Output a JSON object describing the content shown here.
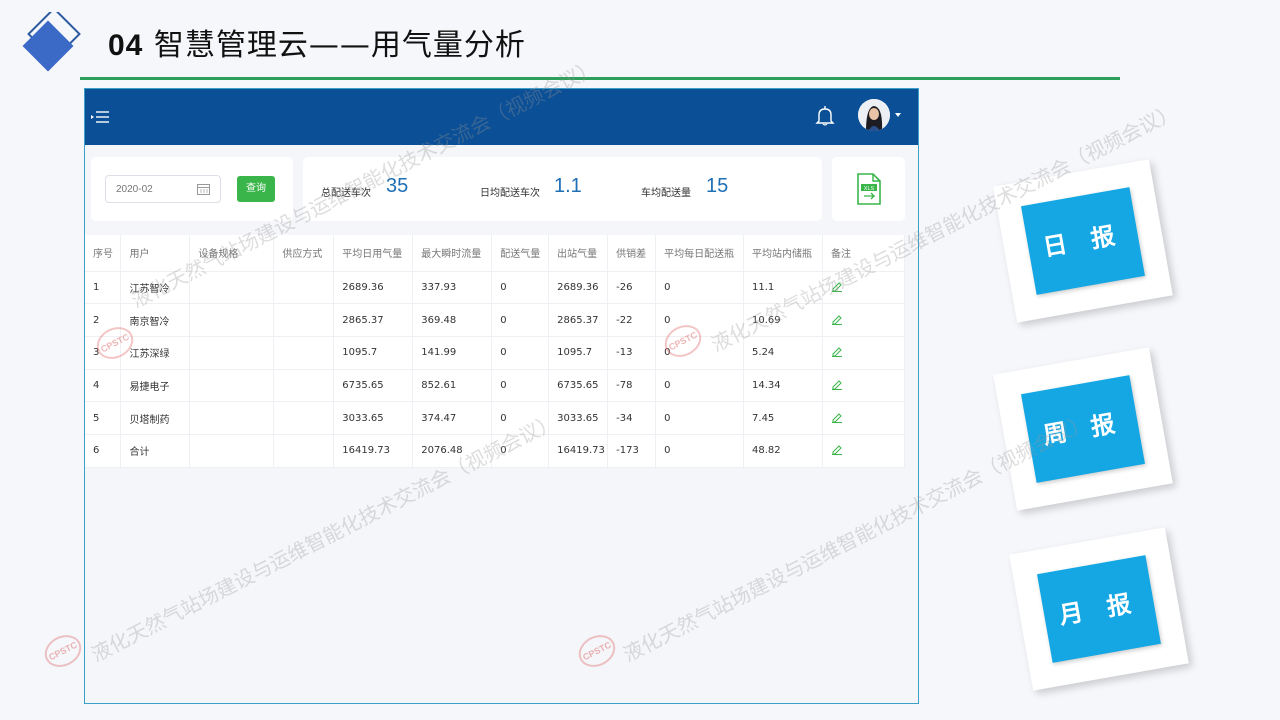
{
  "slide": {
    "title_number": "04",
    "title_text": "智慧管理云——用气量分析"
  },
  "query": {
    "date_value": "2020-02",
    "query_button": "查询"
  },
  "stats": [
    {
      "label": "总配送车次",
      "value": "35"
    },
    {
      "label": "日均配送车次",
      "value": "1.1"
    },
    {
      "label": "车均配送量",
      "value": "15"
    }
  ],
  "export": {
    "icon_text": "XLS"
  },
  "table": {
    "headers": [
      "序号",
      "用户",
      "设备规格",
      "供应方式",
      "平均日用气量",
      "最大瞬时流量",
      "配送气量",
      "出站气量",
      "供销差",
      "平均每日配送瓶",
      "平均站内储瓶",
      "备注"
    ],
    "rows": [
      [
        "1",
        "江苏智冷",
        "",
        "",
        "2689.36",
        "337.93",
        "0",
        "2689.36",
        "-26",
        "0",
        "11.1",
        ""
      ],
      [
        "2",
        "南京智冷",
        "",
        "",
        "2865.37",
        "369.48",
        "0",
        "2865.37",
        "-22",
        "0",
        "10.69",
        ""
      ],
      [
        "3",
        "江苏深绿",
        "",
        "",
        "1095.7",
        "141.99",
        "0",
        "1095.7",
        "-13",
        "0",
        "5.24",
        ""
      ],
      [
        "4",
        "易捷电子",
        "",
        "",
        "6735.65",
        "852.61",
        "0",
        "6735.65",
        "-78",
        "0",
        "14.34",
        ""
      ],
      [
        "5",
        "贝塔制药",
        "",
        "",
        "3033.65",
        "374.47",
        "0",
        "3033.65",
        "-34",
        "0",
        "7.45",
        ""
      ],
      [
        "6",
        "合计",
        "",
        "",
        "16419.73",
        "2076.48",
        "0",
        "16419.73",
        "-173",
        "0",
        "48.82",
        ""
      ]
    ]
  },
  "reports": {
    "daily": "日 报",
    "weekly": "周 报",
    "monthly": "月 报"
  },
  "watermark": {
    "text": "液化天然气站场建设与运维智能化技术交流会（视频会议）",
    "badge": "CPSTC"
  },
  "colors": {
    "topbar": "#0b4f96",
    "accent_green": "#3ab54a",
    "stat_blue": "#1f6fb5",
    "report_blue": "#15a7e3",
    "title_rule": "#2e9e5b"
  }
}
